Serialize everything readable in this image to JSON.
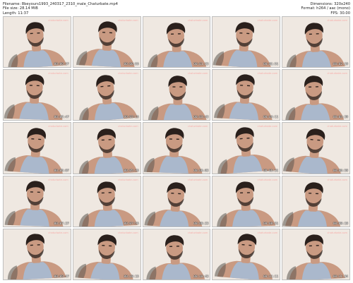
{
  "info": {
    "filename": "Filename: 8beyours1993_240317_2310_male_Chaturbate.mp4",
    "filesize": "File size: 28.14 MiB",
    "length": "Length: 11:37",
    "dimensions": "Dimensions: 320x240",
    "format": "Format: h264 / aac (mono)",
    "fps": "FPS: 30.00"
  },
  "colors": {
    "skin": "#c99a82",
    "hair": "#2a201c",
    "tank": "#aab8cc",
    "tattoo": "#5b5550",
    "background": "#efe8e1"
  },
  "thumbnails": [
    {
      "timestamp": "00:00:27",
      "watermark": "chaturbate.com"
    },
    {
      "timestamp": "00:00:55",
      "watermark": "chaturbate.com"
    },
    {
      "timestamp": "00:01:23",
      "watermark": "chaturbate.com"
    },
    {
      "timestamp": "00:01:51",
      "watermark": "chaturbate.com"
    },
    {
      "timestamp": "00:02:19",
      "watermark": "chaturbate.com"
    },
    {
      "timestamp": "00:02:47",
      "watermark": "chaturbate.com"
    },
    {
      "timestamp": "00:03:15",
      "watermark": "chaturbate.com"
    },
    {
      "timestamp": "00:03:43",
      "watermark": "chaturbate.com"
    },
    {
      "timestamp": "00:04:11",
      "watermark": "chaturbate.com"
    },
    {
      "timestamp": "00:04:39",
      "watermark": "chaturbate.com"
    },
    {
      "timestamp": "00:05:07",
      "watermark": "chaturbate.com"
    },
    {
      "timestamp": "00:05:35",
      "watermark": "chaturbate.com"
    },
    {
      "timestamp": "00:06:03",
      "watermark": "chaturbate.com"
    },
    {
      "timestamp": "00:06:31",
      "watermark": "chaturbate.com"
    },
    {
      "timestamp": "00:06:59",
      "watermark": "chaturbate.com"
    },
    {
      "timestamp": "00:07:27",
      "watermark": "chaturbate.com"
    },
    {
      "timestamp": "00:07:55",
      "watermark": "chaturbate.com"
    },
    {
      "timestamp": "00:08:23",
      "watermark": "chaturbate.com"
    },
    {
      "timestamp": "00:08:51",
      "watermark": "chaturbate.com"
    },
    {
      "timestamp": "00:09:19",
      "watermark": "chaturbate.com"
    },
    {
      "timestamp": "00:09:47",
      "watermark": "chaturbate.com"
    },
    {
      "timestamp": "00:10:15",
      "watermark": "chaturbate.com"
    },
    {
      "timestamp": "00:10:43",
      "watermark": "chaturbate.com"
    },
    {
      "timestamp": "00:11:11",
      "watermark": "chaturbate.com"
    },
    {
      "timestamp": "00:11:34",
      "watermark": "chaturbate.com"
    }
  ]
}
